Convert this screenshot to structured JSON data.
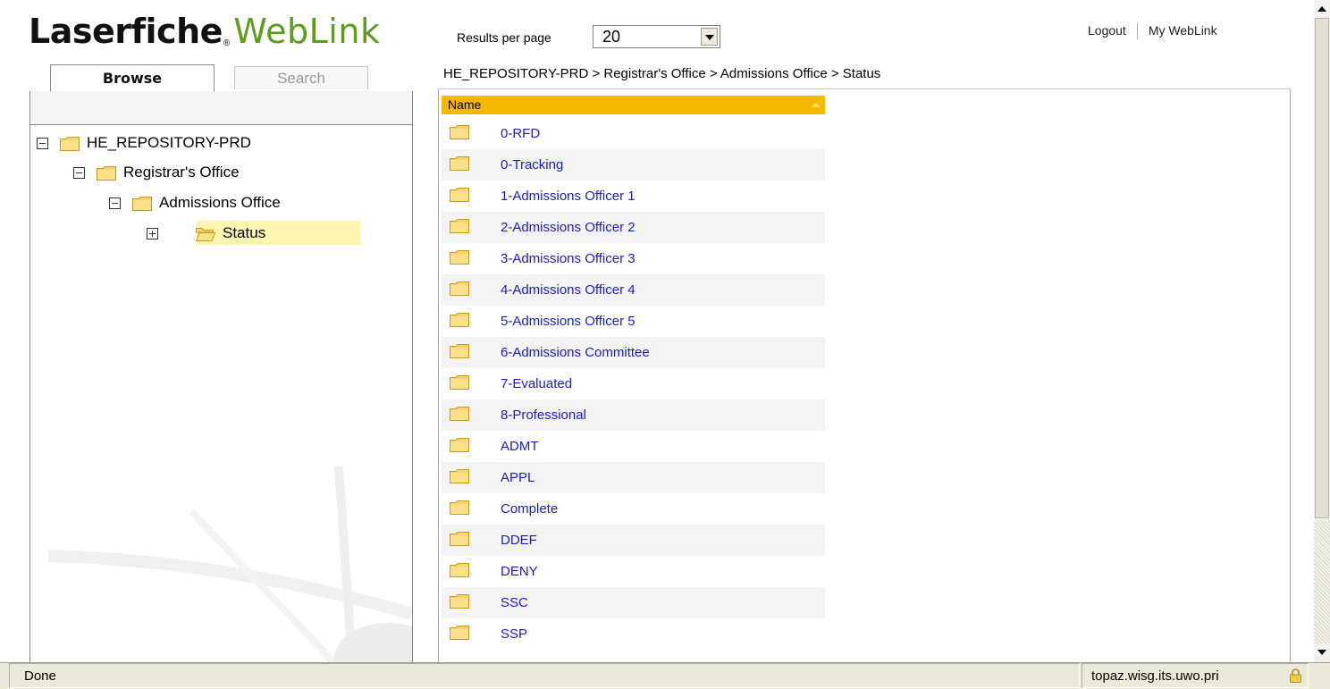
{
  "header": {
    "logo_laserfiche": "Laserfiche",
    "logo_reg": "®",
    "logo_weblink": "WebLink",
    "results_per_page_label": "Results per page",
    "results_per_page_value": "20",
    "logout": "Logout",
    "my_weblink": "My WebLink"
  },
  "tabs": {
    "browse": "Browse",
    "search": "Search"
  },
  "breadcrumb": "HE_REPOSITORY-PRD > Registrar's Office > Admissions Office > Status",
  "tree": [
    {
      "label": "HE_REPOSITORY-PRD",
      "toggle": "minus"
    },
    {
      "label": "Registrar's Office",
      "toggle": "minus"
    },
    {
      "label": "Admissions Office",
      "toggle": "minus"
    },
    {
      "label": "Status",
      "toggle": "plus",
      "selected": true
    }
  ],
  "list": {
    "column_header": "Name",
    "items": [
      "0-RFD",
      "0-Tracking",
      "1-Admissions Officer 1",
      "2-Admissions Officer 2",
      "3-Admissions Officer 3",
      "4-Admissions Officer 4",
      "5-Admissions Officer 5",
      "6-Admissions Committee",
      "7-Evaluated",
      "8-Professional",
      "ADMT",
      "APPL",
      "Complete",
      "DDEF",
      "DENY",
      "SSC",
      "SSP"
    ]
  },
  "status": {
    "text": "Done",
    "host": "topaz.wisg.its.uwo.pri"
  },
  "colors": {
    "header_bar": "#f5b800",
    "link": "#1a1ad6",
    "brand_green": "#5a9e1a",
    "selection": "#fdf5b0"
  }
}
